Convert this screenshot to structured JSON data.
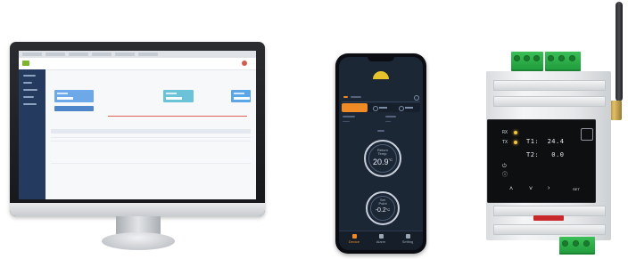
{
  "colors": {
    "phone_accent": "#f08a24",
    "terminal_green": "#2bb04a",
    "led_amber": "#f2c53a",
    "dashboard_sidebar": "#243a5e"
  },
  "phone": {
    "gauges": [
      {
        "caption": "Return\nTemp.",
        "value": "20.9",
        "unit": "°C"
      },
      {
        "caption": "Set\nPoint",
        "value": "-0.2",
        "unit": "°C"
      }
    ],
    "nav": [
      {
        "label": "Device",
        "icon": "device-icon",
        "active": true
      },
      {
        "label": "Alarm",
        "icon": "alarm-icon",
        "active": false
      },
      {
        "label": "Setting",
        "icon": "settings-icon",
        "active": false
      }
    ]
  },
  "controller": {
    "leds": [
      "RX",
      "TX"
    ],
    "lines": [
      "T1:  24.4",
      "T2:   0.0"
    ],
    "buttons": {
      "set": "SET"
    }
  }
}
